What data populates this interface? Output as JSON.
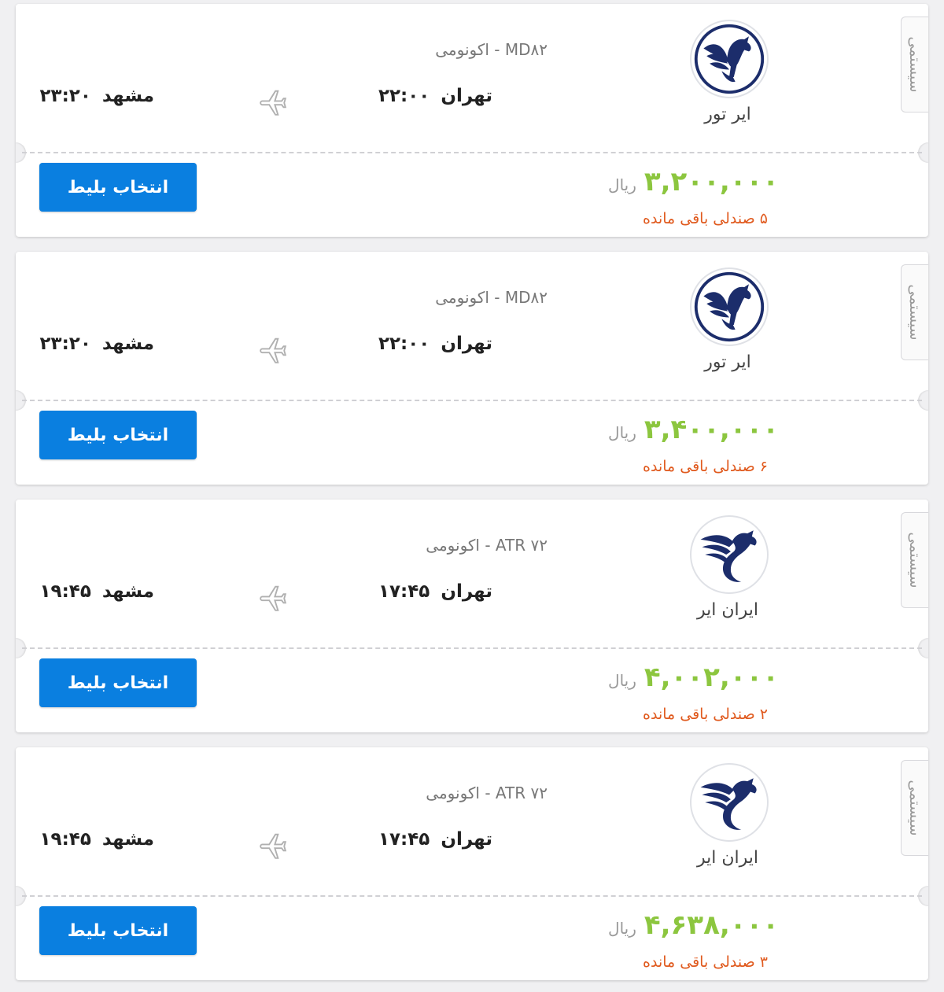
{
  "colors": {
    "price": "#8cc63f",
    "seats": "#e05a1e",
    "button": "#0a7fe0",
    "logo_navy": "#1c2d6b"
  },
  "flights": [
    {
      "tag": "سیستمی",
      "logo": "air-tour-pegasus-logo",
      "airline": "ایر تور",
      "aircraft": "MD۸۲ - اکونومی",
      "origin_city": "تهران",
      "origin_time": "۲۲:۰۰",
      "dest_city": "مشهد",
      "dest_time": "۲۳:۲۰",
      "price": "۳,۲۰۰,۰۰۰",
      "currency": "ریال",
      "seats": "۵ صندلی باقی مانده",
      "button": "انتخاب بلیط"
    },
    {
      "tag": "سیستمی",
      "logo": "air-tour-pegasus-logo",
      "airline": "ایر تور",
      "aircraft": "MD۸۲ - اکونومی",
      "origin_city": "تهران",
      "origin_time": "۲۲:۰۰",
      "dest_city": "مشهد",
      "dest_time": "۲۳:۲۰",
      "price": "۳,۴۰۰,۰۰۰",
      "currency": "ریال",
      "seats": "۶ صندلی باقی مانده",
      "button": "انتخاب بلیط"
    },
    {
      "tag": "سیستمی",
      "logo": "iran-air-homa-logo",
      "airline": "ایران ایر",
      "aircraft": "ATR ۷۲ - اکونومی",
      "origin_city": "تهران",
      "origin_time": "۱۷:۴۵",
      "dest_city": "مشهد",
      "dest_time": "۱۹:۴۵",
      "price": "۴,۰۰۲,۰۰۰",
      "currency": "ریال",
      "seats": "۲ صندلی باقی مانده",
      "button": "انتخاب بلیط"
    },
    {
      "tag": "سیستمی",
      "logo": "iran-air-homa-logo",
      "airline": "ایران ایر",
      "aircraft": "ATR ۷۲ - اکونومی",
      "origin_city": "تهران",
      "origin_time": "۱۷:۴۵",
      "dest_city": "مشهد",
      "dest_time": "۱۹:۴۵",
      "price": "۴,۶۳۸,۰۰۰",
      "currency": "ریال",
      "seats": "۳ صندلی باقی مانده",
      "button": "انتخاب بلیط"
    }
  ]
}
